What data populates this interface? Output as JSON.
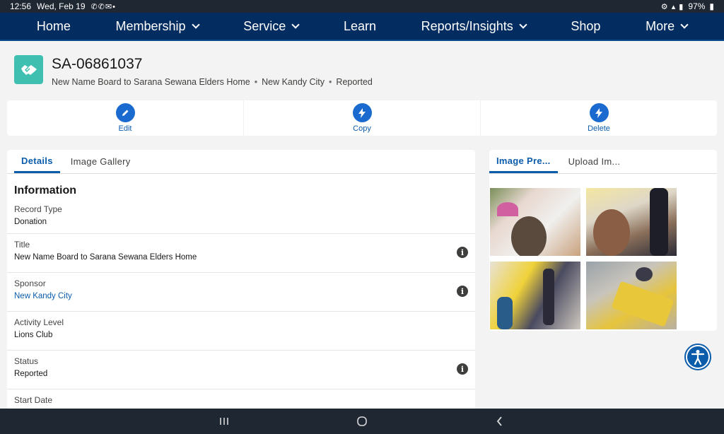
{
  "status_bar": {
    "time": "12:56",
    "date": "Wed, Feb 19",
    "battery": "97%"
  },
  "nav": {
    "items": [
      {
        "label": "Home",
        "dropdown": false
      },
      {
        "label": "Membership",
        "dropdown": true
      },
      {
        "label": "Service",
        "dropdown": true
      },
      {
        "label": "Learn",
        "dropdown": false
      },
      {
        "label": "Reports/Insights",
        "dropdown": true
      },
      {
        "label": "Shop",
        "dropdown": false
      },
      {
        "label": "More",
        "dropdown": true
      }
    ]
  },
  "record": {
    "id": "SA-06861037",
    "name": "New Name Board to Sarana Sewana Elders Home",
    "sponsor": "New Kandy City",
    "status": "Reported",
    "icon_color": "#3ebfb0"
  },
  "actions": {
    "edit": "Edit",
    "copy": "Copy",
    "delete": "Delete"
  },
  "details": {
    "tabs": [
      "Details",
      "Image Gallery"
    ],
    "section_title": "Information",
    "fields": {
      "record_type_label": "Record Type",
      "record_type_value": "Donation",
      "title_label": "Title",
      "title_value": "New Name Board to Sarana Sewana Elders Home",
      "sponsor_label": "Sponsor",
      "sponsor_value": "New Kandy City",
      "activity_label": "Activity Level",
      "activity_value": "Lions Club",
      "status_label": "Status",
      "status_value": "Reported",
      "start_label": "Start Date"
    }
  },
  "images": {
    "tabs": [
      "Image Pre...",
      "Upload Im..."
    ]
  },
  "colors": {
    "nav_bg": "#032d60",
    "brand_blue": "#0b5cab",
    "action_blue": "#1b6ad0"
  }
}
